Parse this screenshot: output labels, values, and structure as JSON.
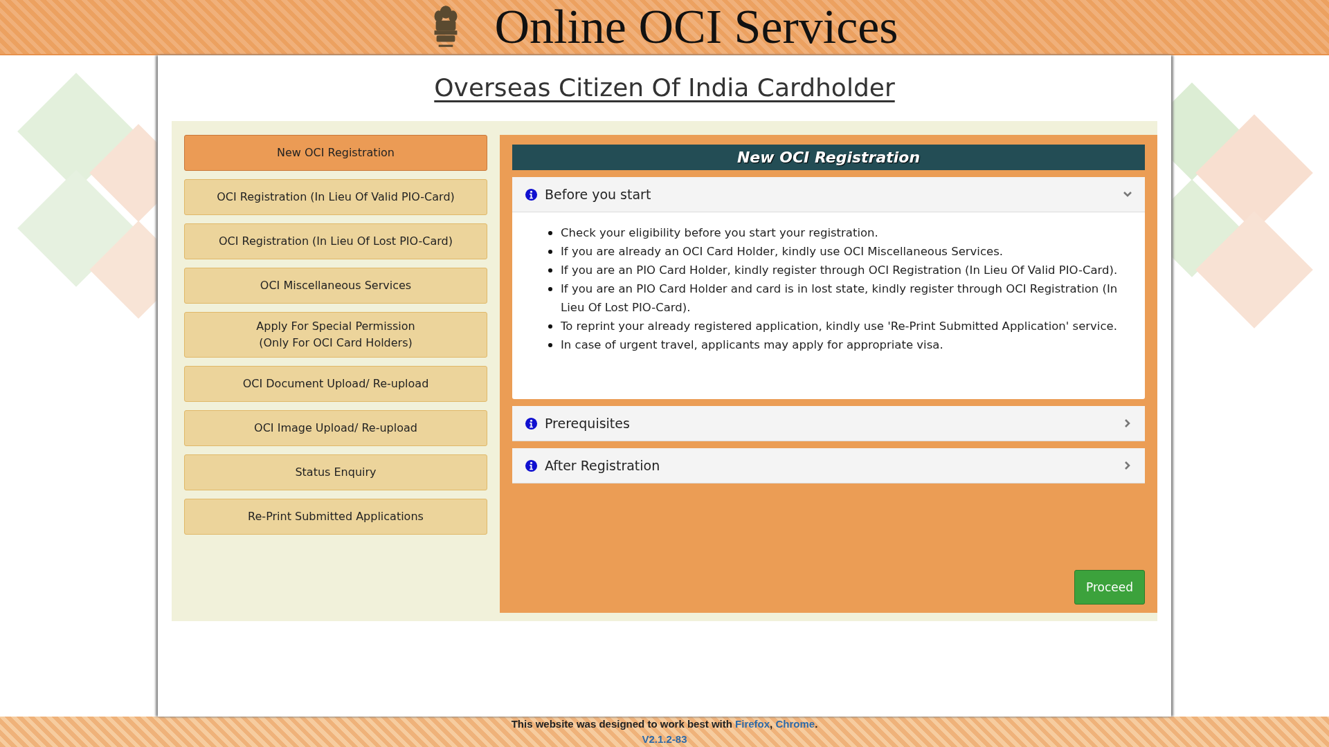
{
  "header": {
    "title": "Online OCI Services"
  },
  "page_title": "Overseas Citizen Of India Cardholder",
  "menu": [
    {
      "label": "New OCI Registration",
      "selected": true
    },
    {
      "label": "OCI Registration (In Lieu Of Valid PIO-Card)",
      "selected": false
    },
    {
      "label": "OCI Registration (In Lieu Of Lost PIO-Card)",
      "selected": false
    },
    {
      "label": "OCI Miscellaneous Services",
      "selected": false
    },
    {
      "label": "Apply For Special Permission\n(Only For OCI Card Holders)",
      "selected": false
    },
    {
      "label": "OCI Document Upload/ Re-upload",
      "selected": false
    },
    {
      "label": "OCI Image Upload/ Re-upload",
      "selected": false
    },
    {
      "label": "Status Enquiry",
      "selected": false
    },
    {
      "label": "Re-Print Submitted Applications",
      "selected": false
    }
  ],
  "panel": {
    "title": "New OCI Registration",
    "sections": [
      {
        "title": "Before you start",
        "expanded": true,
        "items": [
          "Check your eligibility before you start your registration.",
          "If you are already an OCI Card Holder, kindly use OCI Miscellaneous Services.",
          "If you are an PIO Card Holder, kindly register through OCI Registration (In Lieu Of Valid PIO-Card).",
          "If you are an PIO Card Holder and card is in lost state, kindly register through OCI Registration (In Lieu Of Lost PIO-Card).",
          "To reprint your already registered application, kindly use 'Re-Print Submitted Application' service.",
          "In case of urgent travel, applicants may apply for appropriate visa."
        ]
      },
      {
        "title": "Prerequisites",
        "expanded": false
      },
      {
        "title": "After Registration",
        "expanded": false
      }
    ],
    "button": "Proceed"
  },
  "footer": {
    "note": [
      {
        "kind": "plain",
        "text": "This website was designed to work best with "
      },
      {
        "kind": "link",
        "text": "Firefox"
      },
      {
        "kind": "plain",
        "text": ", "
      },
      {
        "kind": "link",
        "text": "Chrome"
      },
      {
        "kind": "plain",
        "text": "."
      }
    ],
    "version": "V2.1.2-83"
  }
}
